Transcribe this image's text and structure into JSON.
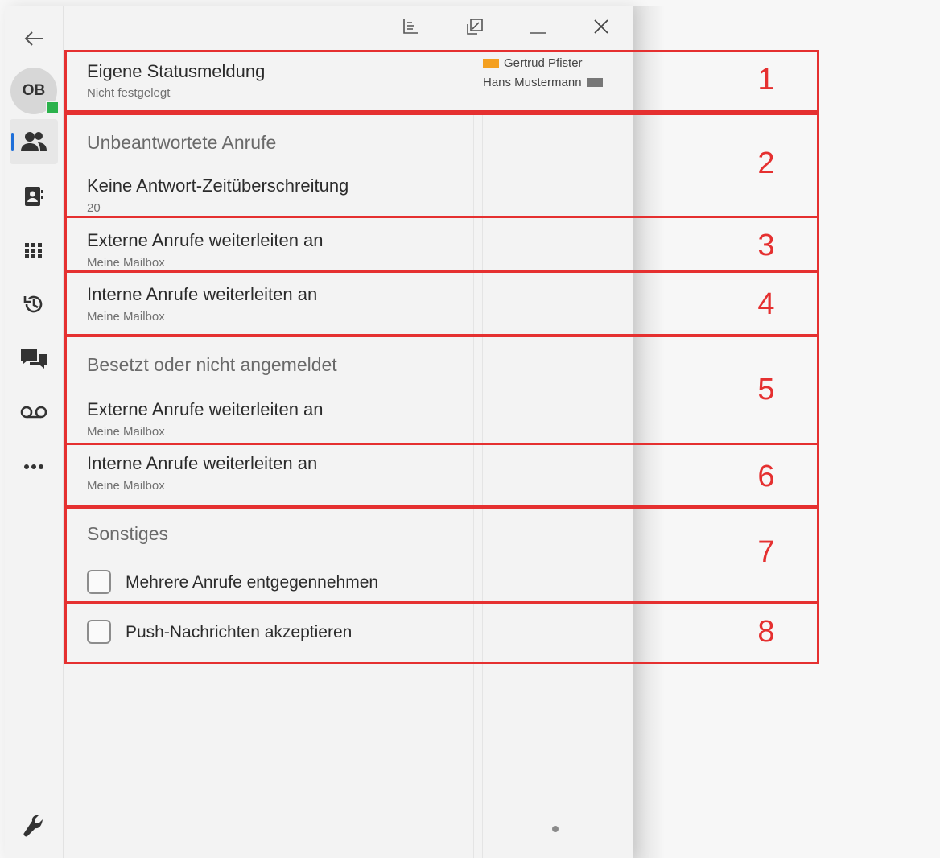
{
  "sidebar": {
    "avatar_initials": "OB",
    "presence_color": "#2bb24c",
    "items": [
      {
        "name": "back-arrow-icon"
      },
      {
        "name": "contacts-icon",
        "active": true
      },
      {
        "name": "addressbook-icon"
      },
      {
        "name": "dialpad-icon"
      },
      {
        "name": "history-icon"
      },
      {
        "name": "chat-icon"
      },
      {
        "name": "voicemail-icon"
      },
      {
        "name": "more-icon"
      },
      {
        "name": "wrench-icon"
      }
    ]
  },
  "status": {
    "title": "Eigene Statusmeldung",
    "value": "Nicht festgelegt",
    "legend": [
      {
        "label": "Gertrud Pfister",
        "color": "#f4a020"
      },
      {
        "label": "Hans Mustermann",
        "color": "#777777"
      }
    ]
  },
  "unanswered": {
    "heading": "Unbeantwortete Anrufe",
    "timeout_label": "Keine Antwort-Zeitüberschreitung",
    "timeout_value": "20"
  },
  "external_forward_1": {
    "label": "Externe Anrufe weiterleiten an",
    "value": "Meine Mailbox"
  },
  "internal_forward_1": {
    "label": "Interne Anrufe weiterleiten an",
    "value": "Meine Mailbox"
  },
  "busy": {
    "heading": "Besetzt oder nicht angemeldet",
    "external_label": "Externe Anrufe weiterleiten an",
    "external_value": "Meine Mailbox"
  },
  "internal_forward_2": {
    "label": "Interne Anrufe weiterleiten an",
    "value": "Meine Mailbox"
  },
  "misc": {
    "heading": "Sonstiges",
    "multiple_calls_label": "Mehrere Anrufe entgegennehmen",
    "multiple_calls_checked": false
  },
  "push": {
    "label": "Push-Nachrichten akzeptieren",
    "checked": false
  },
  "annotations": [
    "1",
    "2",
    "3",
    "4",
    "5",
    "6",
    "7",
    "8"
  ],
  "colors": {
    "annotation": "#e53030",
    "accent": "#1e6fd9"
  }
}
